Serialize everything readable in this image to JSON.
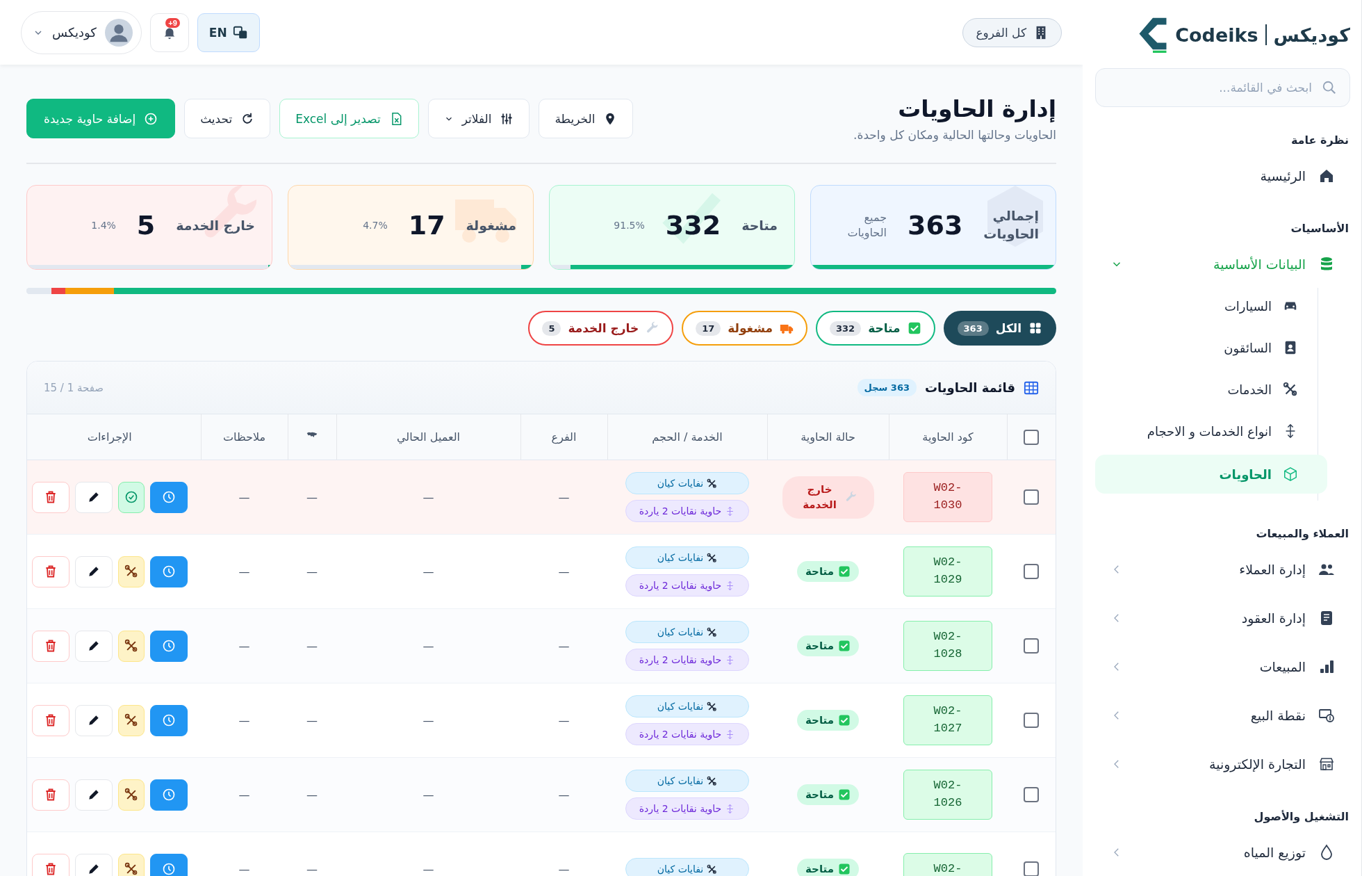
{
  "sidebar": {
    "logo": {
      "name_ar": "كوديكس",
      "name_en": "Codeiks"
    },
    "search": {
      "placeholder": "ابحث في القائمة..."
    },
    "sections": [
      {
        "title": "نظرة عامة",
        "items": [
          {
            "label": "الرئيسية",
            "selected": false
          }
        ]
      },
      {
        "title": "الأساسيات",
        "items": [
          {
            "label": "البيانات الأساسية",
            "selected": false,
            "expanded": true,
            "children": [
              {
                "label": "السيارات",
                "selected": false
              },
              {
                "label": "السائقون",
                "selected": false
              },
              {
                "label": "الخدمات",
                "selected": false
              },
              {
                "label": "انواع الخدمات و الاحجام",
                "selected": false
              },
              {
                "label": "الحاويات",
                "selected": true
              }
            ]
          }
        ]
      },
      {
        "title": "العملاء والمبيعات",
        "items": [
          {
            "label": "إدارة العملاء",
            "selected": false,
            "expanded": false
          },
          {
            "label": "إدارة العقود",
            "selected": false,
            "expanded": false
          },
          {
            "label": "المبيعات",
            "selected": false,
            "expanded": false
          },
          {
            "label": "نقطة البيع",
            "selected": false,
            "expanded": false
          },
          {
            "label": "التجارة الإلكترونية",
            "selected": false,
            "expanded": false
          }
        ]
      },
      {
        "title": "التشغيل والأصول",
        "items": [
          {
            "label": "توزيع المياه",
            "selected": false,
            "expanded": false
          }
        ]
      }
    ]
  },
  "topbar": {
    "branch": "كل الفروع",
    "language": "EN",
    "notifications": "+9",
    "user": "كوديكس"
  },
  "header": {
    "title": "إدارة الحاويات",
    "subtitle": "الحاويات وحالتها الحالية ومكان كل واحدة.",
    "buttons": [
      {
        "kind": "map",
        "label": "الخريطة"
      },
      {
        "kind": "filters",
        "label": "الفلاتر"
      },
      {
        "kind": "export",
        "label": "تصدير إلى Excel"
      },
      {
        "kind": "refresh",
        "label": "تحديث"
      },
      {
        "kind": "add",
        "label": "إضافة حاوية جديدة"
      }
    ]
  },
  "stats": [
    {
      "kind": "total",
      "label": "إجمالي الحاويات",
      "value": "363",
      "note": "جميع الحاويات",
      "level": 1
    },
    {
      "kind": "available",
      "label": "متاحة",
      "value": "332",
      "note": "91.5%",
      "level": 0.915
    },
    {
      "kind": "busy",
      "label": "مشغولة",
      "value": "17",
      "note": "4.7%",
      "level": 0.047
    },
    {
      "kind": "out",
      "label": "خارج الخدمة",
      "value": "5",
      "note": "1.4%",
      "level": 0.014
    }
  ],
  "distribution": [
    {
      "level": 0.915,
      "color": "#10b981"
    },
    {
      "level": 0.047,
      "color": "#f59e0b"
    },
    {
      "level": 0.014,
      "color": "#ef4444"
    },
    {
      "level": 0.024,
      "color": "#e2e8f0"
    }
  ],
  "chips": [
    {
      "kind": "all",
      "label": "الكل",
      "count": "363",
      "selected": true
    },
    {
      "kind": "available",
      "label": "متاحة",
      "count": "332",
      "selected": false
    },
    {
      "kind": "busy",
      "label": "مشغولة",
      "count": "17",
      "selected": false
    },
    {
      "kind": "out",
      "label": "خارج الخدمة",
      "count": "5",
      "selected": false
    }
  ],
  "table": {
    "title": "قائمة الحاويات",
    "count": "363 سجل",
    "page": "صفحة 1 / 15",
    "columns": [
      {
        "kind": "select",
        "checked": false
      },
      {
        "kind": "text",
        "label": "كود الحاوية"
      },
      {
        "kind": "text",
        "label": "حالة الحاوية"
      },
      {
        "kind": "text",
        "label": "الخدمة / الحجم"
      },
      {
        "kind": "text",
        "label": "الفرع"
      },
      {
        "kind": "text",
        "label": "العميل الحالي"
      },
      {
        "kind": "location"
      },
      {
        "kind": "text",
        "label": "ملاحظات"
      },
      {
        "kind": "text",
        "label": "الإجراءات"
      }
    ],
    "rows": [
      {
        "checked": false,
        "code": "W02-1030",
        "status": {
          "kind": "out",
          "label": "خارج الخدمة"
        },
        "service": "نفايات كيان",
        "size": "حاوية نقايات 2 ياردة",
        "branch": "—",
        "customer": "—",
        "location": "—",
        "notes": "—"
      },
      {
        "checked": false,
        "code": "W02-1029",
        "status": {
          "kind": "available",
          "label": "متاحة"
        },
        "service": "نفايات كيان",
        "size": "حاوية نقايات 2 ياردة",
        "branch": "—",
        "customer": "—",
        "location": "—",
        "notes": "—"
      },
      {
        "checked": false,
        "code": "W02-1028",
        "status": {
          "kind": "available",
          "label": "متاحة"
        },
        "service": "نفايات كيان",
        "size": "حاوية نقايات 2 ياردة",
        "branch": "—",
        "customer": "—",
        "location": "—",
        "notes": "—"
      },
      {
        "checked": false,
        "code": "W02-1027",
        "status": {
          "kind": "available",
          "label": "متاحة"
        },
        "service": "نفايات كيان",
        "size": "حاوية نقايات 2 ياردة",
        "branch": "—",
        "customer": "—",
        "location": "—",
        "notes": "—"
      },
      {
        "checked": false,
        "code": "W02-1026",
        "status": {
          "kind": "available",
          "label": "متاحة"
        },
        "service": "نفايات كيان",
        "size": "حاوية نقايات 2 ياردة",
        "branch": "—",
        "customer": "—",
        "location": "—",
        "notes": "—"
      },
      {
        "checked": false,
        "code": "W02-",
        "status": {
          "kind": "available",
          "label": "متاحة"
        },
        "service": "نفايات كيان",
        "branch": "—",
        "customer": "—",
        "location": "—",
        "notes": "—"
      }
    ]
  }
}
